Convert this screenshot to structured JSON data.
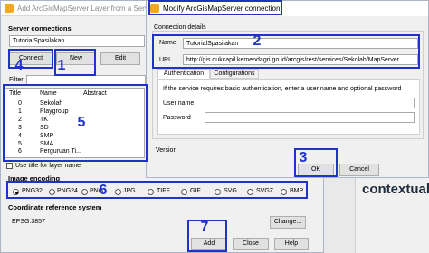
{
  "context_label": "contextual c",
  "back_window": {
    "title": "Add ArcGisMapServer Layer from a Server",
    "server_connections_label": "Server connections",
    "server_selected": "TutorialSpasilakan",
    "buttons": {
      "connect": "Connect",
      "new": "New",
      "edit": "Edit"
    },
    "filter_label": "Filter:",
    "columns": {
      "title": "Title",
      "name": "Name",
      "abstract": "Abstract"
    },
    "rows": [
      {
        "title": "0",
        "name": "Sekolah"
      },
      {
        "title": "1",
        "name": "Playgroup"
      },
      {
        "title": "2",
        "name": "TK"
      },
      {
        "title": "3",
        "name": "SD"
      },
      {
        "title": "4",
        "name": "SMP"
      },
      {
        "title": "5",
        "name": "SMA"
      },
      {
        "title": "6",
        "name": "Perguruan Ti..."
      }
    ],
    "use_title_label": "Use title for layer name",
    "image_encoding_label": "Image encoding",
    "encodings": [
      "PNG32",
      "PNG24",
      "PNG",
      "JPG",
      "TIFF",
      "GIF",
      "SVG",
      "SVGZ",
      "BMP"
    ],
    "encoding_selected": "PNG32",
    "crs_label": "Coordinate reference system",
    "crs_value": "EPSG:3857",
    "change_label": "Change...",
    "add_label": "Add",
    "close_label": "Close",
    "help_label": "Help"
  },
  "dialog": {
    "title": "Modify ArcGisMapServer connection",
    "connection_details_label": "Connection details",
    "name_label": "Name",
    "name_value": "TutorialSpasilakan",
    "url_label": "URL",
    "url_value": "http://gis.dukcapil.kemendagri.go.id/arcgis/rest/services/Sekolah/MapServer",
    "tabs": [
      "Authentication",
      "Configurations"
    ],
    "auth_text": "If the service requires basic authentication, enter a user name and optional password",
    "user_label": "User name",
    "password_label": "Password",
    "version_label": "Version",
    "ok_label": "OK",
    "cancel_label": "Cancel"
  },
  "annotations": [
    "1",
    "2",
    "3",
    "4",
    "5",
    "6",
    "7"
  ],
  "colors": {
    "annotation": "#1f33c9",
    "window_icon": "#f5a623"
  }
}
